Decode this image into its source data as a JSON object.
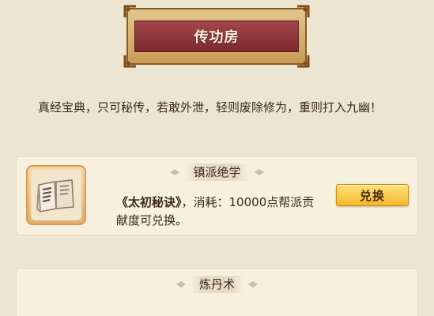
{
  "header": {
    "title": "传功房"
  },
  "description": "真经宝典，只可秘传，若敢外泄，轻则废除修为，重则打入九幽！",
  "sections": [
    {
      "heading": "镇派绝学",
      "item_icon": "book-icon",
      "book_title": "《太初秘诀》",
      "cost_text": "，消耗：10000点帮派贡献度可兑换。",
      "button_label": "兑换"
    },
    {
      "heading": "炼丹术"
    }
  ],
  "colors": {
    "banner_red": "#8e3a3e",
    "banner_gold": "#d8b06a",
    "button_gold": "#f2b72c",
    "background": "#ece5d2",
    "card": "#f6f0df"
  }
}
